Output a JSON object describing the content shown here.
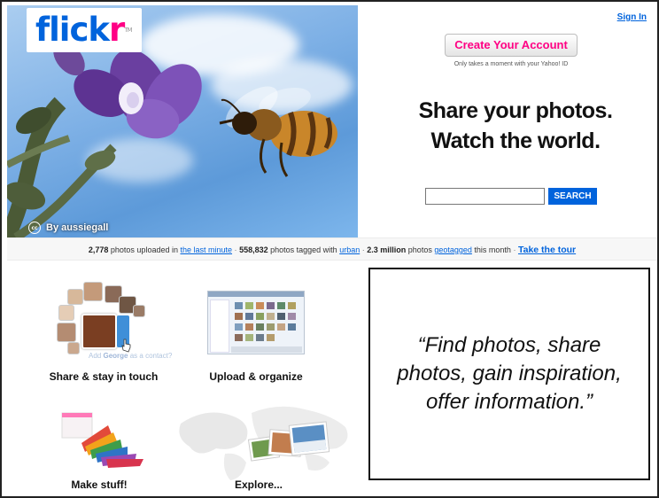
{
  "header": {
    "logo": {
      "part1": "flick",
      "part2": "r",
      "tm": "TM"
    },
    "sign_in": "Sign In",
    "photo_credit": "By aussiegall"
  },
  "signup": {
    "button_label": "Create Your Account",
    "note": "Only takes a moment with your Yahoo! ID"
  },
  "headline": {
    "line1": "Share your photos.",
    "line2": "Watch the world."
  },
  "search": {
    "value": "",
    "button_label": "SEARCH"
  },
  "stats": {
    "count1": "2,778",
    "text1": "photos uploaded in",
    "link1": "the last minute",
    "count2": "558,832",
    "text2": "photos tagged with",
    "link2": "urban",
    "count3": "2.3 million",
    "text3": "photos",
    "link3": "geotagged",
    "text4": "this month",
    "tour": "Take the tour"
  },
  "features": {
    "share_label": "Share & stay in touch",
    "share_ghost_pre": "Add",
    "share_ghost_name": "George",
    "share_ghost_post": "as a contact?",
    "upload_label": "Upload & organize",
    "make_label": "Make stuff!",
    "explore_label": "Explore..."
  },
  "quote": "“Find photos, share photos, gain inspiration, offer information.”",
  "colors": {
    "flickr_blue": "#0063dc",
    "flickr_pink": "#ff0084"
  }
}
